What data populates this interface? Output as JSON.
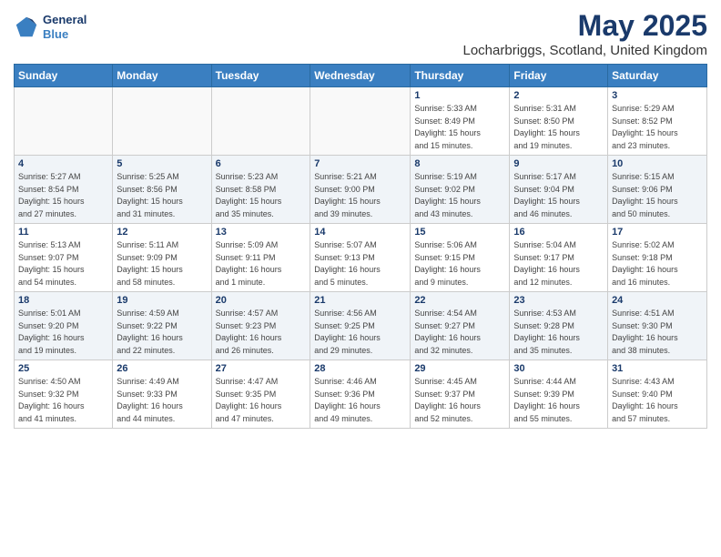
{
  "header": {
    "logo": {
      "general": "General",
      "blue": "Blue"
    },
    "month": "May 2025",
    "location": "Locharbriggs, Scotland, United Kingdom"
  },
  "weekdays": [
    "Sunday",
    "Monday",
    "Tuesday",
    "Wednesday",
    "Thursday",
    "Friday",
    "Saturday"
  ],
  "weeks": [
    [
      {
        "day": "",
        "info": ""
      },
      {
        "day": "",
        "info": ""
      },
      {
        "day": "",
        "info": ""
      },
      {
        "day": "",
        "info": ""
      },
      {
        "day": "1",
        "info": "Sunrise: 5:33 AM\nSunset: 8:49 PM\nDaylight: 15 hours\nand 15 minutes."
      },
      {
        "day": "2",
        "info": "Sunrise: 5:31 AM\nSunset: 8:50 PM\nDaylight: 15 hours\nand 19 minutes."
      },
      {
        "day": "3",
        "info": "Sunrise: 5:29 AM\nSunset: 8:52 PM\nDaylight: 15 hours\nand 23 minutes."
      }
    ],
    [
      {
        "day": "4",
        "info": "Sunrise: 5:27 AM\nSunset: 8:54 PM\nDaylight: 15 hours\nand 27 minutes."
      },
      {
        "day": "5",
        "info": "Sunrise: 5:25 AM\nSunset: 8:56 PM\nDaylight: 15 hours\nand 31 minutes."
      },
      {
        "day": "6",
        "info": "Sunrise: 5:23 AM\nSunset: 8:58 PM\nDaylight: 15 hours\nand 35 minutes."
      },
      {
        "day": "7",
        "info": "Sunrise: 5:21 AM\nSunset: 9:00 PM\nDaylight: 15 hours\nand 39 minutes."
      },
      {
        "day": "8",
        "info": "Sunrise: 5:19 AM\nSunset: 9:02 PM\nDaylight: 15 hours\nand 43 minutes."
      },
      {
        "day": "9",
        "info": "Sunrise: 5:17 AM\nSunset: 9:04 PM\nDaylight: 15 hours\nand 46 minutes."
      },
      {
        "day": "10",
        "info": "Sunrise: 5:15 AM\nSunset: 9:06 PM\nDaylight: 15 hours\nand 50 minutes."
      }
    ],
    [
      {
        "day": "11",
        "info": "Sunrise: 5:13 AM\nSunset: 9:07 PM\nDaylight: 15 hours\nand 54 minutes."
      },
      {
        "day": "12",
        "info": "Sunrise: 5:11 AM\nSunset: 9:09 PM\nDaylight: 15 hours\nand 58 minutes."
      },
      {
        "day": "13",
        "info": "Sunrise: 5:09 AM\nSunset: 9:11 PM\nDaylight: 16 hours\nand 1 minute."
      },
      {
        "day": "14",
        "info": "Sunrise: 5:07 AM\nSunset: 9:13 PM\nDaylight: 16 hours\nand 5 minutes."
      },
      {
        "day": "15",
        "info": "Sunrise: 5:06 AM\nSunset: 9:15 PM\nDaylight: 16 hours\nand 9 minutes."
      },
      {
        "day": "16",
        "info": "Sunrise: 5:04 AM\nSunset: 9:17 PM\nDaylight: 16 hours\nand 12 minutes."
      },
      {
        "day": "17",
        "info": "Sunrise: 5:02 AM\nSunset: 9:18 PM\nDaylight: 16 hours\nand 16 minutes."
      }
    ],
    [
      {
        "day": "18",
        "info": "Sunrise: 5:01 AM\nSunset: 9:20 PM\nDaylight: 16 hours\nand 19 minutes."
      },
      {
        "day": "19",
        "info": "Sunrise: 4:59 AM\nSunset: 9:22 PM\nDaylight: 16 hours\nand 22 minutes."
      },
      {
        "day": "20",
        "info": "Sunrise: 4:57 AM\nSunset: 9:23 PM\nDaylight: 16 hours\nand 26 minutes."
      },
      {
        "day": "21",
        "info": "Sunrise: 4:56 AM\nSunset: 9:25 PM\nDaylight: 16 hours\nand 29 minutes."
      },
      {
        "day": "22",
        "info": "Sunrise: 4:54 AM\nSunset: 9:27 PM\nDaylight: 16 hours\nand 32 minutes."
      },
      {
        "day": "23",
        "info": "Sunrise: 4:53 AM\nSunset: 9:28 PM\nDaylight: 16 hours\nand 35 minutes."
      },
      {
        "day": "24",
        "info": "Sunrise: 4:51 AM\nSunset: 9:30 PM\nDaylight: 16 hours\nand 38 minutes."
      }
    ],
    [
      {
        "day": "25",
        "info": "Sunrise: 4:50 AM\nSunset: 9:32 PM\nDaylight: 16 hours\nand 41 minutes."
      },
      {
        "day": "26",
        "info": "Sunrise: 4:49 AM\nSunset: 9:33 PM\nDaylight: 16 hours\nand 44 minutes."
      },
      {
        "day": "27",
        "info": "Sunrise: 4:47 AM\nSunset: 9:35 PM\nDaylight: 16 hours\nand 47 minutes."
      },
      {
        "day": "28",
        "info": "Sunrise: 4:46 AM\nSunset: 9:36 PM\nDaylight: 16 hours\nand 49 minutes."
      },
      {
        "day": "29",
        "info": "Sunrise: 4:45 AM\nSunset: 9:37 PM\nDaylight: 16 hours\nand 52 minutes."
      },
      {
        "day": "30",
        "info": "Sunrise: 4:44 AM\nSunset: 9:39 PM\nDaylight: 16 hours\nand 55 minutes."
      },
      {
        "day": "31",
        "info": "Sunrise: 4:43 AM\nSunset: 9:40 PM\nDaylight: 16 hours\nand 57 minutes."
      }
    ]
  ]
}
